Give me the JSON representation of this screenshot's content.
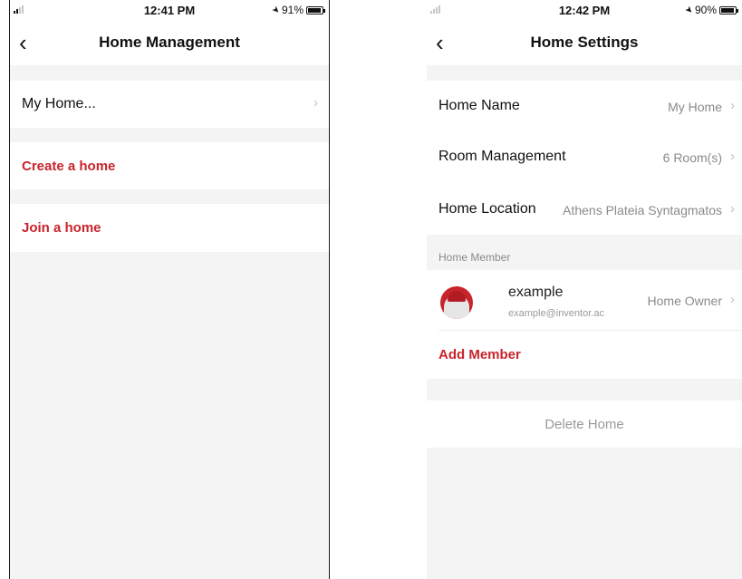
{
  "left_screen": {
    "status": {
      "time": "12:41 PM",
      "battery": "91%",
      "battery_level": 0.91
    },
    "nav": {
      "title": "Home Management"
    },
    "homes": [
      {
        "label": "My Home..."
      }
    ],
    "actions": {
      "create": "Create a home",
      "join": "Join a home"
    }
  },
  "right_screen": {
    "status": {
      "time": "12:42 PM",
      "battery": "90%",
      "battery_level": 0.9
    },
    "nav": {
      "title": "Home Settings"
    },
    "settings": [
      {
        "label": "Home Name",
        "value": "My Home"
      },
      {
        "label": "Room Management",
        "value": "6 Room(s)"
      },
      {
        "label": "Home Location",
        "value": "Athens Plateia Syntagmatos"
      }
    ],
    "members_section": {
      "label": "Home Member"
    },
    "members": [
      {
        "name": "example",
        "email": "example@inventor.ac",
        "role": "Home Owner"
      }
    ],
    "add_member": "Add Member",
    "delete_home": "Delete Home"
  },
  "colors": {
    "accent": "#c8242b",
    "background": "#f4f4f5",
    "card": "#ffffff",
    "muted": "#8a8a8a"
  },
  "icons": {
    "back": "chevron-left-icon",
    "disclosure": "chevron-right-icon",
    "location": "location-arrow-icon",
    "battery": "battery-icon",
    "signal": "signal-icon"
  }
}
